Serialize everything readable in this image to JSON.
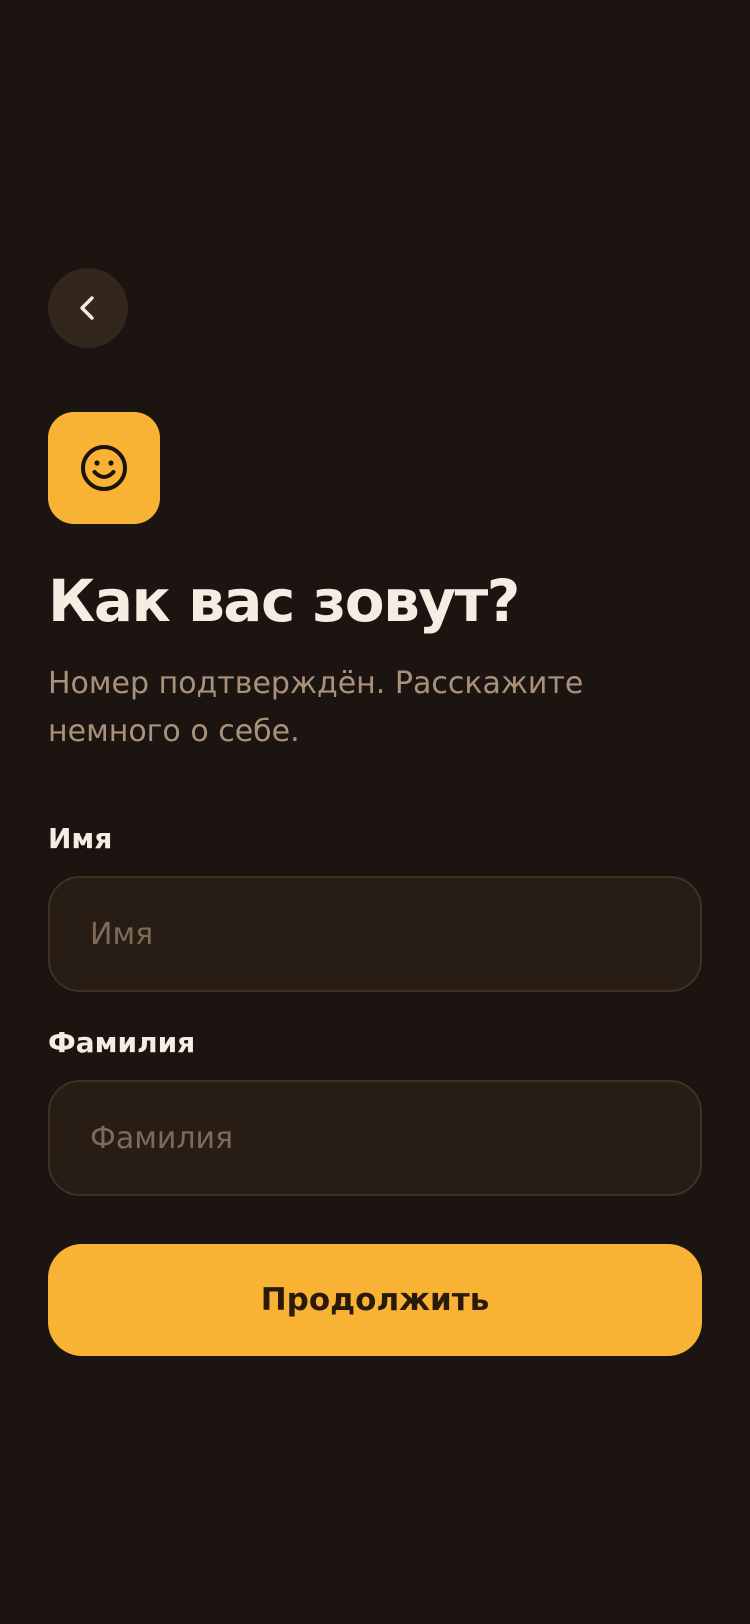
{
  "header": {
    "back_icon": "chevron-left-icon"
  },
  "hero": {
    "icon": "smiley-face-icon",
    "title": "Как вас зовут?",
    "subtitle": "Номер подтверждён. Расскажите немного о себе."
  },
  "form": {
    "first_name": {
      "label": "Имя",
      "placeholder": "Имя",
      "value": ""
    },
    "last_name": {
      "label": "Фамилия",
      "placeholder": "Фамилия",
      "value": ""
    },
    "submit_label": "Продолжить"
  },
  "colors": {
    "background": "#1c1410",
    "accent": "#f8b334",
    "back_button_bg": "#33271d",
    "field_bg": "#281d14",
    "field_border": "#3f3225",
    "title_text": "#f6ede2",
    "muted_text": "#a9927b",
    "placeholder_text": "#7d6a57",
    "button_text": "#2a1a0d"
  }
}
